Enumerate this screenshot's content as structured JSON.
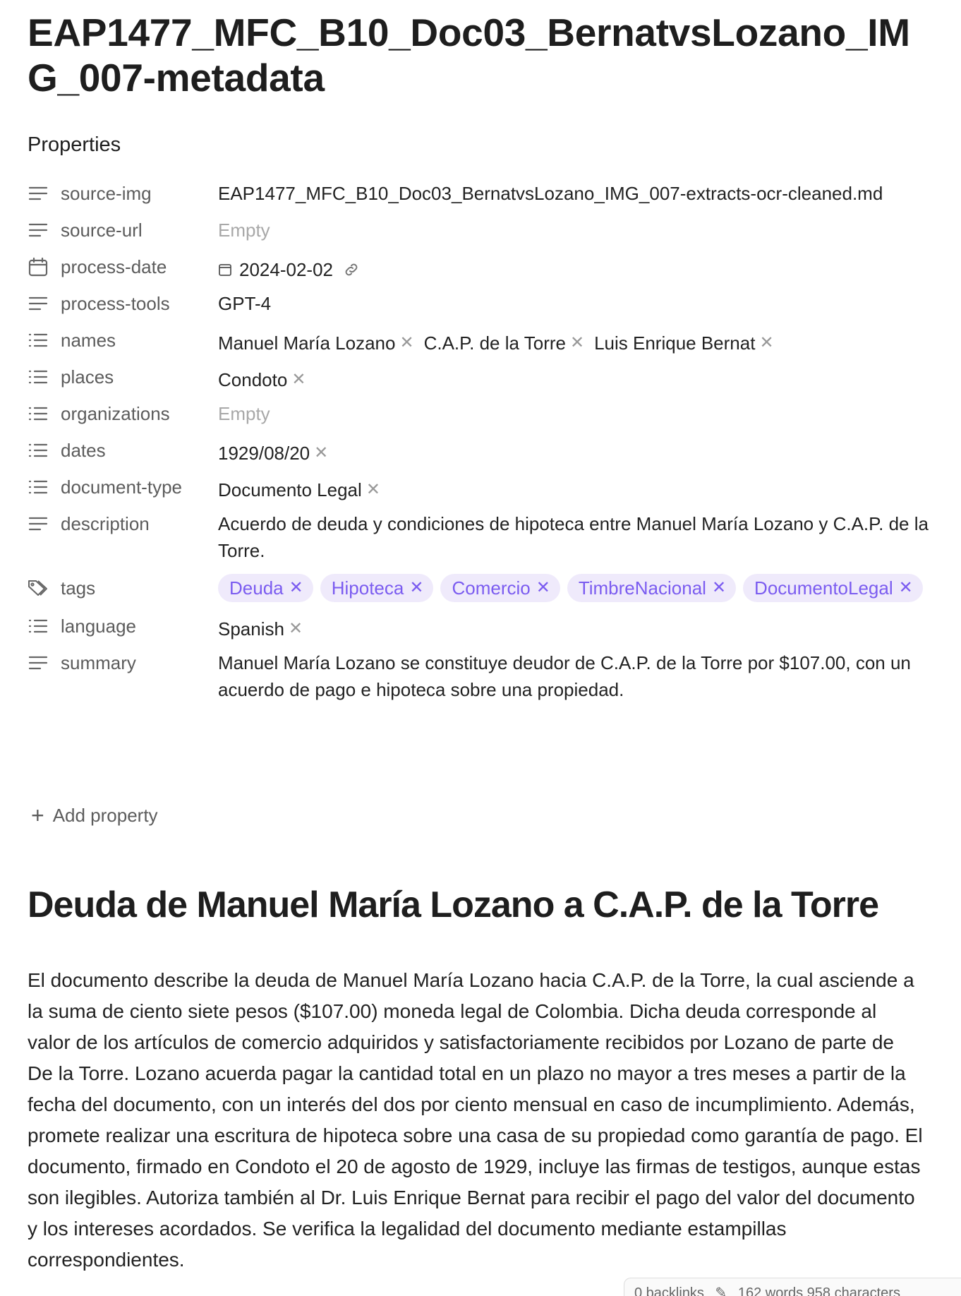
{
  "note": {
    "title": "EAP1477_MFC_B10_Doc03_BernatvsLozano_IMG_007-metadata"
  },
  "properties": {
    "heading": "Properties",
    "source_img": {
      "key": "source-img",
      "value": "EAP1477_MFC_B10_Doc03_BernatvsLozano_IMG_007-extracts-ocr-cleaned.md",
      "icon": "text-lines-icon"
    },
    "source_url": {
      "key": "source-url",
      "value": "Empty",
      "icon": "text-lines-icon"
    },
    "process_date": {
      "key": "process-date",
      "value": "2024-02-02",
      "icon": "calendar-icon"
    },
    "process_tools": {
      "key": "process-tools",
      "value": "GPT-4",
      "icon": "text-lines-icon"
    },
    "names": {
      "key": "names",
      "items": [
        "Manuel María Lozano",
        "C.A.P. de la Torre",
        "Luis Enrique Bernat"
      ],
      "icon": "list-icon"
    },
    "places": {
      "key": "places",
      "items": [
        "Condoto"
      ],
      "icon": "list-icon"
    },
    "organizations": {
      "key": "organizations",
      "value": "Empty",
      "icon": "list-icon"
    },
    "dates": {
      "key": "dates",
      "items": [
        "1929/08/20"
      ],
      "icon": "list-icon"
    },
    "document_type": {
      "key": "document-type",
      "items": [
        "Documento Legal"
      ],
      "icon": "list-icon"
    },
    "description": {
      "key": "description",
      "value": "Acuerdo de deuda y condiciones de hipoteca entre Manuel María Lozano y C.A.P. de la Torre.",
      "icon": "text-lines-icon"
    },
    "tags": {
      "key": "tags",
      "items": [
        "Deuda",
        "Hipoteca",
        "Comercio",
        "TimbreNacional",
        "DocumentoLegal"
      ],
      "icon": "tag-icon"
    },
    "language": {
      "key": "language",
      "items": [
        "Spanish"
      ],
      "icon": "list-icon"
    },
    "summary": {
      "key": "summary",
      "value": "Manuel María Lozano se constituye deudor de C.A.P. de la Torre por $107.00, con un acuerdo de pago e hipoteca sobre una propiedad.",
      "icon": "text-lines-icon"
    },
    "add_label": "Add property"
  },
  "document": {
    "heading": "Deuda de Manuel María Lozano a C.A.P. de la Torre",
    "body": "El documento describe la deuda de Manuel María Lozano hacia C.A.P. de la Torre, la cual asciende a la suma de ciento siete pesos ($107.00) moneda legal de Colombia. Dicha deuda corresponde al valor de los artículos de comercio adquiridos y satisfactoriamente recibidos por Lozano de parte de De la Torre. Lozano acuerda pagar la cantidad total en un plazo no mayor a tres meses a partir de la fecha del documento, con un interés del dos por ciento mensual en caso de incumplimiento. Además, promete realizar una escritura de hipoteca sobre una casa de su propiedad como garantía de pago. El documento, firmado en Condoto el 20 de agosto de 1929, incluye las firmas de testigos, aunque estas son ilegibles. Autoriza también al Dr. Luis Enrique Bernat para recibir el pago del valor del documento y los intereses acordados. Se verifica la legalidad del documento mediante estampillas correspondientes."
  },
  "status_bar": {
    "backlinks": "0 backlinks",
    "counts": "162 words  958 characters"
  },
  "colors": {
    "tag_bg": "#efeafb",
    "tag_text": "#7b5cf0",
    "empty_text": "#a8a8a8"
  }
}
